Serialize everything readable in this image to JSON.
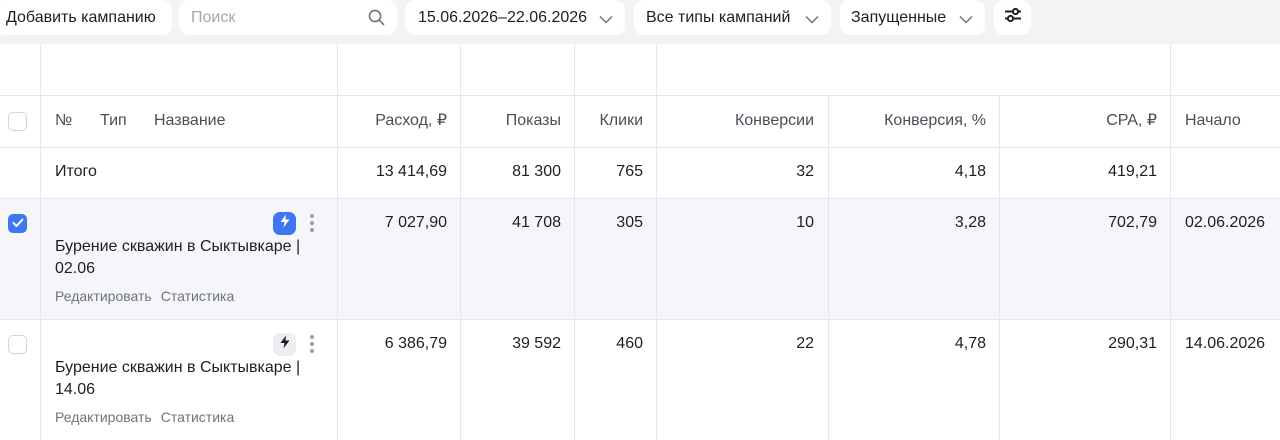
{
  "toolbar": {
    "add_campaign_label": "Добавить кампанию",
    "search_placeholder": "Поиск",
    "date_range": "15.06.2026–22.06.2026",
    "campaign_types": "Все типы кампаний",
    "status_filter": "Запущенные"
  },
  "columns": {
    "num": "№",
    "type": "Тип",
    "name": "Название",
    "spend": "Расход, ₽",
    "impressions": "Показы",
    "clicks": "Клики",
    "conversions": "Конверсии",
    "conversion_rate": "Конверсия, %",
    "cpa": "CPA, ₽",
    "start": "Начало"
  },
  "total": {
    "label": "Итого",
    "spend": "13 414,69",
    "impressions": "81 300",
    "clicks": "765",
    "conversions": "32",
    "conversion_rate": "4,18",
    "cpa": "419,21"
  },
  "rows": [
    {
      "name_line1": "Бурение скважин в Сыктывкаре |",
      "name_line2": "02.06",
      "edit": "Редактировать",
      "stats": "Статистика",
      "spend": "7 027,90",
      "impressions": "41 708",
      "clicks": "305",
      "conversions": "10",
      "conversion_rate": "3,28",
      "cpa": "702,79",
      "start": "02.06.2026",
      "selected": true
    },
    {
      "name_line1": "Бурение скважин в Сыктывкаре |",
      "name_line2": "14.06",
      "edit": "Редактировать",
      "stats": "Статистика",
      "spend": "6 386,79",
      "impressions": "39 592",
      "clicks": "460",
      "conversions": "22",
      "conversion_rate": "4,78",
      "cpa": "290,31",
      "start": "14.06.2026",
      "selected": false
    }
  ],
  "icons": {
    "search": "search-icon",
    "chevron": "chevron-down-icon",
    "filter": "sliders-icon",
    "bolt": "lightning-icon",
    "more": "more-vertical-icon",
    "check": "check-icon"
  },
  "colors": {
    "accent": "#3e77f0",
    "toolbar_bg": "#f2f3f5",
    "selected_row_bg": "#f5f6f9"
  }
}
